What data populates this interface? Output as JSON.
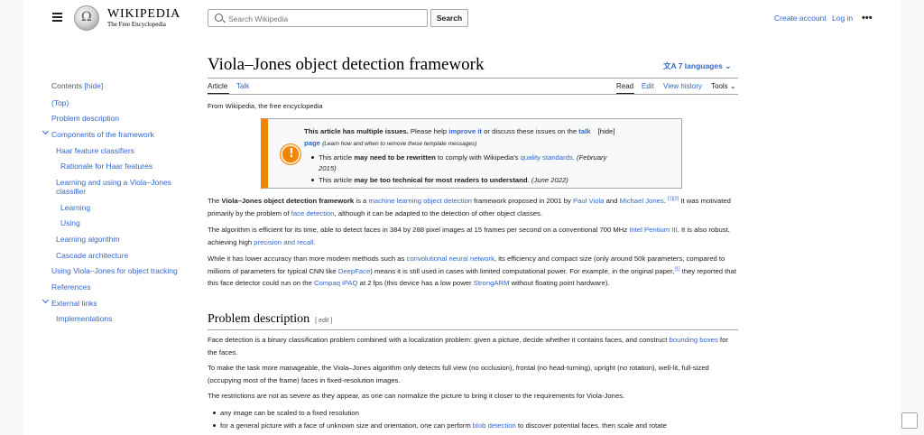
{
  "header": {
    "logo_word": "WIKIPEDIA",
    "logo_tagline": "The Free Encyclopedia",
    "search_placeholder": "Search Wikipedia",
    "search_button": "Search",
    "create_account": "Create account",
    "login": "Log in",
    "more": "•••"
  },
  "toc": {
    "title": "Contents",
    "hide": "[hide]",
    "items": [
      "(Top)",
      "Problem description",
      "Components of the framework",
      "Haar feature classifiers",
      "Rationale for Haar features",
      "Learning and using a Viola–Jones",
      "classifier",
      "Learning",
      "Using",
      "Learning algorithm",
      "Cascade architecture",
      "Using Viola–Jones for object tracking",
      "References",
      "External links",
      "Implementations"
    ]
  },
  "article": {
    "title": "Viola–Jones object detection framework",
    "languages": "7 languages",
    "tabs": [
      "Article",
      "Talk"
    ],
    "actions": [
      "Read",
      "Edit",
      "View history",
      "Tools"
    ],
    "from": "From Wikipedia, the free encyclopedia"
  },
  "ambox": {
    "l1a": "This article has multiple issues.",
    "l1b": " Please help ",
    "l1c": "improve it",
    "l1d": " or discuss these issues on the ",
    "l1e": "talk",
    "l1f": "[hide]",
    "l2a": "page",
    "l2b": "(Learn how and when to remove these template messages)",
    "b1a": "This article ",
    "b1b": "may need to be rewritten",
    "b1c": " to comply with Wikipedia's ",
    "b1d": "quality standards",
    "b1e": ". ",
    "b1f": "(February",
    "b1g": "2015)",
    "b2a": "This article ",
    "b2b": "may be too technical for most readers to understand",
    "b2c": ". ",
    "b2d": "(June 2022)"
  },
  "paras": {
    "p1": [
      {
        "t": "The "
      },
      {
        "t": "Viola–Jones object detection framework",
        "b": true
      },
      {
        "t": " is a "
      },
      {
        "t": "machine learning",
        "l": true
      },
      {
        "t": " "
      },
      {
        "t": "object detection",
        "l": true
      },
      {
        "t": " framework proposed in 2001 by "
      },
      {
        "t": "Paul Viola",
        "l": true
      },
      {
        "t": " and "
      },
      {
        "t": "Michael Jones",
        "l": true
      },
      {
        "t": ". "
      },
      {
        "t": "[1][2]",
        "l": true,
        "sup": true
      },
      {
        "t": " It was motivated primarily by the problem of "
      },
      {
        "t": "face detection",
        "l": true
      },
      {
        "t": ", although it can be adapted to the detection of other object classes."
      }
    ],
    "p2": [
      {
        "t": "The algorithm is efficient for its time, able to detect faces in 384 by 288 pixel images at 15 frames per second on a conventional 700 MHz "
      },
      {
        "t": "Intel Pentium III",
        "l": true
      },
      {
        "t": ". It is also robust, achieving high "
      },
      {
        "t": "precision and recall",
        "l": true
      },
      {
        "t": "."
      }
    ],
    "p3": [
      {
        "t": "While it has lower accuracy than more modern methods such as "
      },
      {
        "t": "convolutional neural network",
        "l": true
      },
      {
        "t": ", its efficiency and compact size (only around 50k parameters, compared to millions of parameters for typical CNN like "
      },
      {
        "t": "DeepFace",
        "l": true
      },
      {
        "t": ") means it is still used in cases with limited computational power. For example, in the original paper,"
      },
      {
        "t": "[1]",
        "l": true,
        "sup": true
      },
      {
        "t": " they reported that this face detector could run on the "
      },
      {
        "t": "Compaq iPAQ",
        "l": true
      },
      {
        "t": " at 2 fps (this device has a low power "
      },
      {
        "t": "StrongARM",
        "l": true
      },
      {
        "t": " without floating point hardware)."
      }
    ],
    "p4": [
      {
        "t": "Face detection is a binary classification problem combined with a localization problem: given a picture, decide whether it contains faces, and construct "
      },
      {
        "t": "bounding boxes",
        "l": true
      },
      {
        "t": " for the faces."
      }
    ],
    "p5": [
      {
        "t": "To make the task more manageable, the Viola–Jones algorithm only detects full view (no occlusion), frontal (no head-turning), upright (no rotation), well-lit, full-sized (occupying most of the frame) faces in fixed-resolution images."
      }
    ],
    "p6": [
      {
        "t": "The restrictions are not as severe as they appear, as one can normalize the picture to bring it closer to the requirements for Viola-Jones."
      }
    ],
    "li1": [
      {
        "t": "any image can be scaled to a fixed resolution"
      }
    ],
    "li2": [
      {
        "t": "for a general picture with a face of unknown size and orientation, one can perform "
      },
      {
        "t": "blob detection",
        "l": true
      },
      {
        "t": " to discover potential faces, then scale and rotate"
      }
    ]
  },
  "section": {
    "heading": "Problem description",
    "edit": "[ edit ]"
  }
}
